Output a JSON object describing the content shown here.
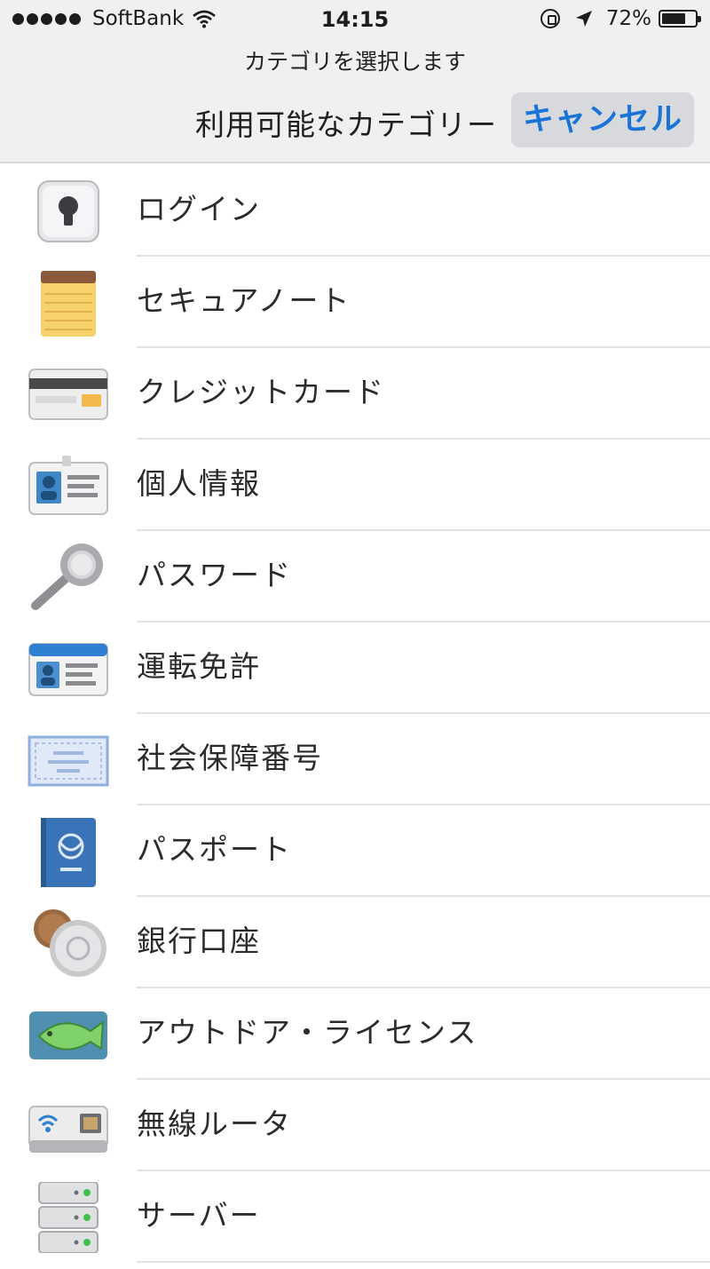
{
  "status_bar": {
    "carrier": "SoftBank",
    "time": "14:15",
    "battery_percent_text": "72%",
    "battery_level": 0.72
  },
  "header": {
    "prompt": "カテゴリを選択します",
    "title": "利用可能なカテゴリー",
    "cancel_label": "キャンセル"
  },
  "categories": [
    {
      "label": "ログイン",
      "icon": "login-lock-icon"
    },
    {
      "label": "セキュアノート",
      "icon": "notepad-icon"
    },
    {
      "label": "クレジットカード",
      "icon": "credit-card-icon"
    },
    {
      "label": "個人情報",
      "icon": "id-badge-icon"
    },
    {
      "label": "パスワード",
      "icon": "key-icon"
    },
    {
      "label": "運転免許",
      "icon": "drivers-license-icon"
    },
    {
      "label": "社会保障番号",
      "icon": "certificate-icon"
    },
    {
      "label": "パスポート",
      "icon": "passport-icon"
    },
    {
      "label": "銀行口座",
      "icon": "coins-icon"
    },
    {
      "label": "アウトドア・ライセンス",
      "icon": "fish-icon"
    },
    {
      "label": "無線ルータ",
      "icon": "router-icon"
    },
    {
      "label": "サーバー",
      "icon": "server-icon"
    }
  ],
  "colors": {
    "accent": "#1a73d6",
    "header_bg": "#eff0f1",
    "separator": "#e2e2e4"
  }
}
